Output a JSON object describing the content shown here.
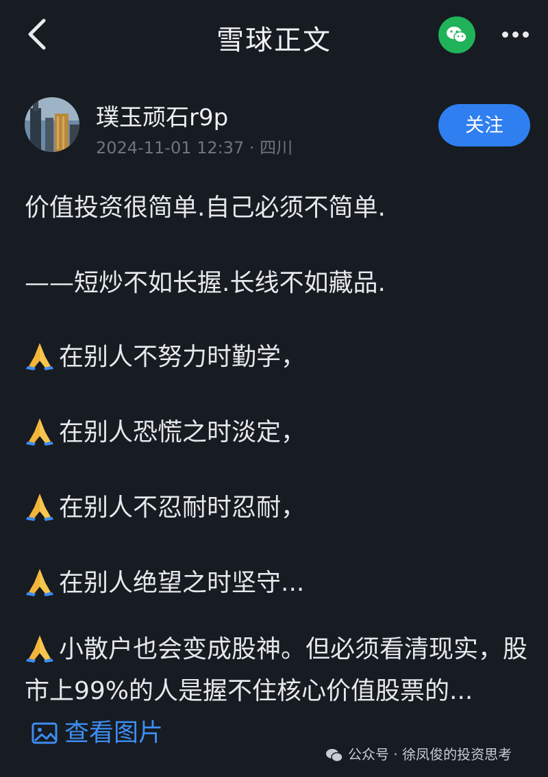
{
  "nav": {
    "title": "雪球正文",
    "back_icon": "chevron-left-icon",
    "share_icon": "wechat-icon",
    "more_icon": "more-horizontal-icon"
  },
  "author": {
    "name": "璞玉顽石r9p",
    "meta": "2024-11-01 12:37 · 四川",
    "follow_label": "关注"
  },
  "post": {
    "lines": [
      "价值投资很简单.自己必须不简单.",
      "——短炒不如长握.长线不如藏品."
    ],
    "pray_lines": [
      "在别人不努力时勤学，",
      "在别人恐慌之时淡定，",
      "在别人不忍耐时忍耐，",
      "在别人绝望之时坚守..."
    ],
    "long_text": "小散户也会变成股神。但必须看清现实，股市上99%的人是握不住核心价值股票的...",
    "view_image_label": "查看图片"
  },
  "watermark": {
    "text": "公众号 · 徐凤俊的投资思考"
  },
  "colors": {
    "background": "#171b22",
    "accent": "#2f7ff0",
    "wechat": "#20b35a",
    "link": "#3d8ef3"
  }
}
